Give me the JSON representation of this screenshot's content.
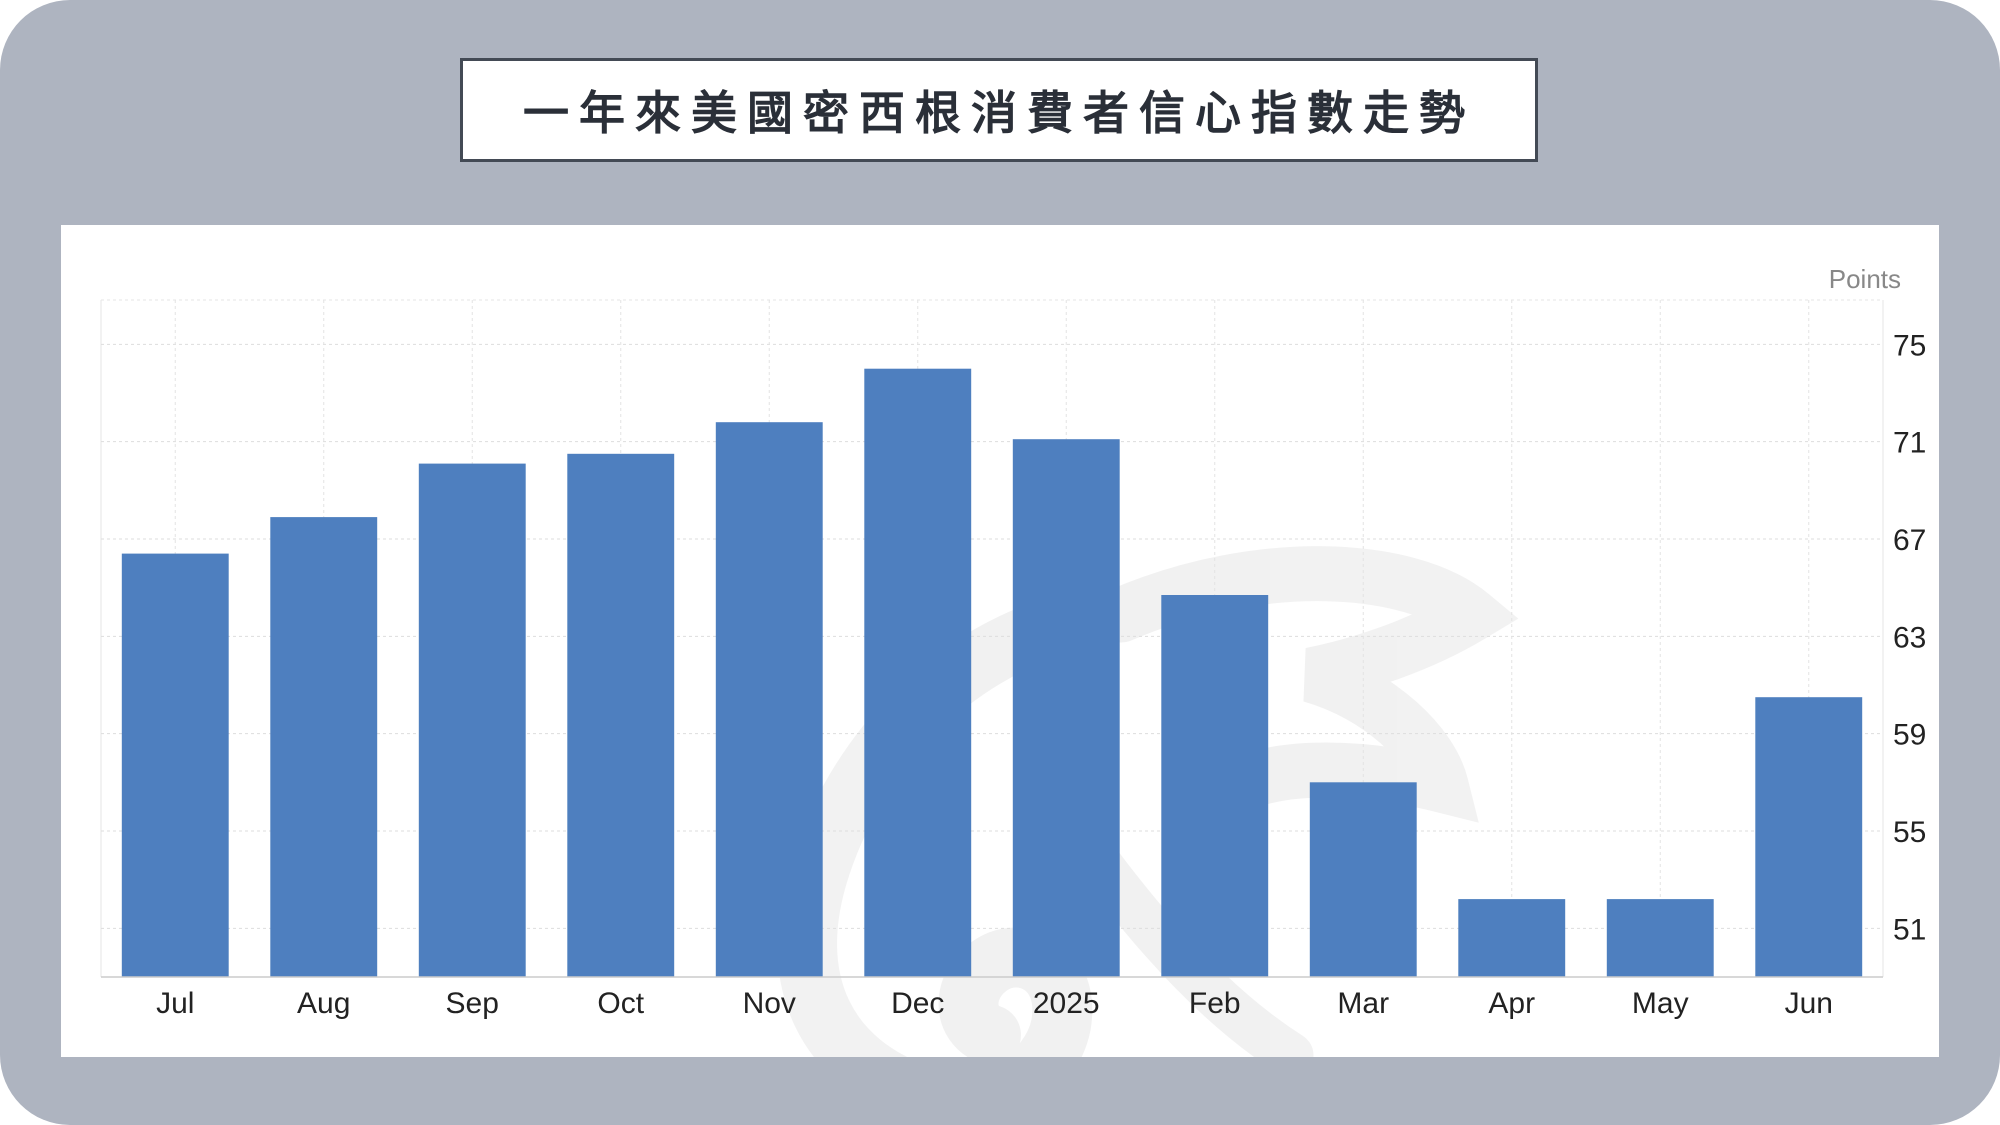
{
  "title": "一年來美國密西根消費者信心指數走勢",
  "chart_data": {
    "type": "bar",
    "title": "一年來美國密西根消費者信心指數走勢",
    "unit": "Points",
    "categories": [
      "Jul",
      "Aug",
      "Sep",
      "Oct",
      "Nov",
      "Dec",
      "2025",
      "Feb",
      "Mar",
      "Apr",
      "May",
      "Jun"
    ],
    "values": [
      66.4,
      67.9,
      70.1,
      70.5,
      71.8,
      74.0,
      71.1,
      64.7,
      57.0,
      52.2,
      52.2,
      60.5
    ],
    "ylim": [
      49,
      76
    ],
    "yticks": [
      51,
      55,
      59,
      63,
      67,
      71,
      75
    ],
    "bar_color": "#4e7fbf",
    "grid": true,
    "xlabel": "",
    "ylabel": ""
  }
}
